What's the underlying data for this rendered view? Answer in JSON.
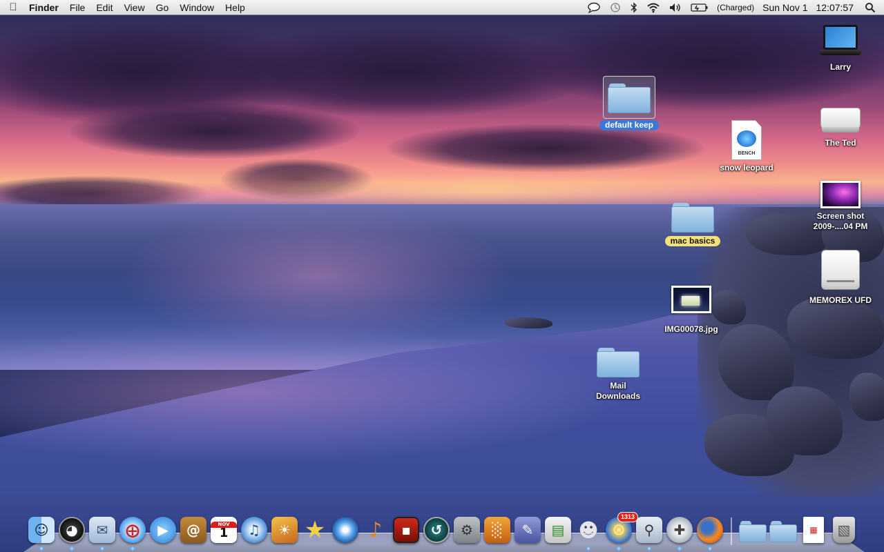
{
  "menubar": {
    "app_name": "Finder",
    "menus": [
      "File",
      "Edit",
      "View",
      "Go",
      "Window",
      "Help"
    ],
    "battery_status": "(Charged)",
    "date": "Sun Nov 1",
    "time": "12:07:57",
    "status_icons": [
      "chat-bubble-icon",
      "time-machine-icon",
      "bluetooth-icon",
      "wifi-icon",
      "volume-icon",
      "battery-icon",
      "spotlight-icon"
    ]
  },
  "desktop": {
    "icons": [
      {
        "label": "Larry",
        "type": "computer"
      },
      {
        "label": "The Ted",
        "type": "hard-drive"
      },
      {
        "label": "Screen shot 2009-....04 PM",
        "type": "image"
      },
      {
        "label": "MEMOREX UFD",
        "type": "usb-drive"
      },
      {
        "label": "default keep",
        "type": "folder",
        "selected": true
      },
      {
        "label": "snow leopard",
        "type": "document",
        "doc_text": "BENCH"
      },
      {
        "label": "mac basics",
        "type": "folder",
        "color_label": "yellow"
      },
      {
        "label": "IMG00078.jpg",
        "type": "image"
      },
      {
        "label": "Mail Downloads",
        "type": "folder"
      }
    ]
  },
  "dock": {
    "apps": [
      {
        "name": "Finder",
        "icon": "finder-icon",
        "running": true
      },
      {
        "name": "Dashboard",
        "icon": "dashboard-icon",
        "running": true
      },
      {
        "name": "Mail",
        "icon": "mail-icon",
        "running": true
      },
      {
        "name": "Safari",
        "icon": "safari-icon",
        "running": true
      },
      {
        "name": "iChat",
        "icon": "ichat-icon",
        "running": false
      },
      {
        "name": "Address Book",
        "icon": "address-book-icon",
        "running": false
      },
      {
        "name": "iCal",
        "icon": "ical-icon",
        "running": false,
        "text": "1",
        "month": "NOV"
      },
      {
        "name": "iTunes",
        "icon": "itunes-icon",
        "running": false
      },
      {
        "name": "iPhoto",
        "icon": "iphoto-icon",
        "running": false
      },
      {
        "name": "iMovie",
        "icon": "imovie-icon",
        "running": false
      },
      {
        "name": "DVD Player",
        "icon": "dvd-player-icon",
        "running": false
      },
      {
        "name": "GarageBand",
        "icon": "garageband-icon",
        "running": false
      },
      {
        "name": "Front Row",
        "icon": "front-row-icon",
        "running": false
      },
      {
        "name": "Time Machine",
        "icon": "time-machine-dock-icon",
        "running": false
      },
      {
        "name": "System Preferences",
        "icon": "system-preferences-icon",
        "running": false
      },
      {
        "name": "Keynote",
        "icon": "keynote-icon",
        "running": false
      },
      {
        "name": "Script Editor",
        "icon": "script-editor-icon",
        "running": false
      },
      {
        "name": "Numbers",
        "icon": "numbers-icon",
        "running": false
      },
      {
        "name": "Adium",
        "icon": "adium-icon",
        "running": true
      },
      {
        "name": "NetNewsWire",
        "icon": "netnewswire-icon",
        "running": true,
        "badge": "1313"
      },
      {
        "name": "Preview",
        "icon": "preview-icon",
        "running": true
      },
      {
        "name": "Disk Utility",
        "icon": "disk-utility-icon",
        "running": true
      },
      {
        "name": "Firefox",
        "icon": "firefox-icon",
        "running": true
      }
    ],
    "stacks": [
      {
        "name": "Applications",
        "icon": "applications-stack-icon"
      },
      {
        "name": "Documents",
        "icon": "documents-stack-icon"
      },
      {
        "name": "PDF Document",
        "icon": "pdf-document-icon"
      },
      {
        "name": "Trash",
        "icon": "trash-icon"
      }
    ]
  }
}
